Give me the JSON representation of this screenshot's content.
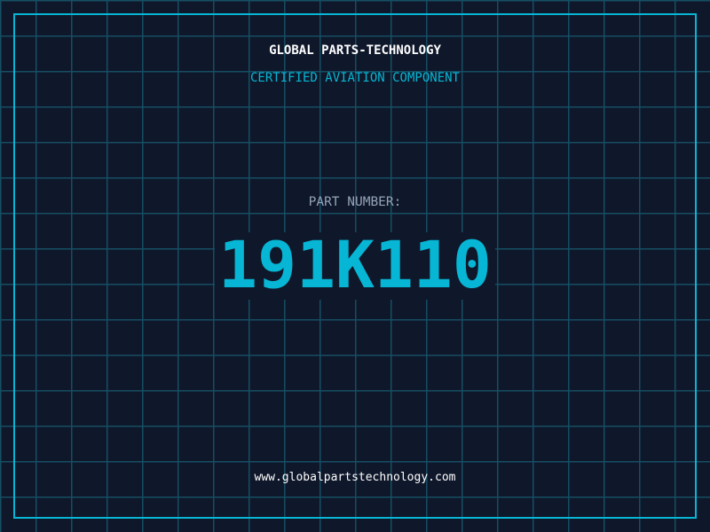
{
  "header": {
    "title": "GLOBAL PARTS-TECHNOLOGY",
    "subtitle": "CERTIFIED AVIATION COMPONENT"
  },
  "part": {
    "label": "PART NUMBER:",
    "number": "191K110"
  },
  "footer": {
    "url": "www.globalpartstechnology.com"
  },
  "colors": {
    "background": "#0f172a",
    "accent": "#06b6d4",
    "grid": "#164e63",
    "label": "#94a3b8"
  }
}
